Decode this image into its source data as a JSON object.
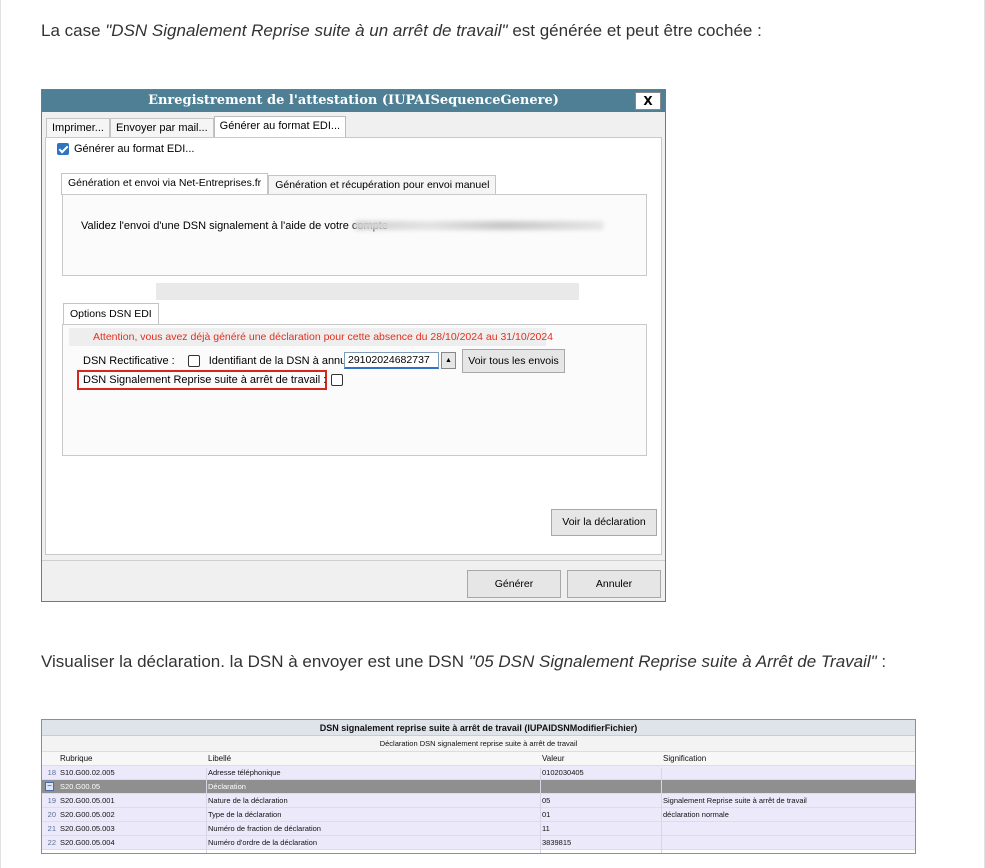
{
  "para1": {
    "before": "La case ",
    "em": "\"DSN Signalement Reprise suite à un arrêt de travail\"",
    "after": " est générée et peut être cochée :"
  },
  "dialog": {
    "title": "Enregistrement de l'attestation (IUPAISequenceGenere)",
    "close": "X",
    "tabs": [
      "Imprimer...",
      "Envoyer par mail...",
      "Générer au format EDI..."
    ],
    "edi_checkbox_label": "Générer au format EDI...",
    "subtabs": [
      "Génération et envoi via Net-Entreprises.fr",
      "Génération et récupération pour envoi manuel"
    ],
    "validate_text": "Validez l'envoi d'une DSN signalement à l'aide de votre compte",
    "options_tab": "Options DSN EDI",
    "warning": "Attention, vous avez déjà généré une déclaration pour cette absence du 28/10/2024 au 31/10/2024",
    "rectificative_label": "DSN Rectificative :",
    "identifiant_label": "Identifiant de la DSN à annuler",
    "identifiant_value": "29102024682737",
    "voir_envois": "Voir tous les envois",
    "reprise_label": "DSN Signalement Reprise suite à arrêt de travail :",
    "voir_declaration": "Voir la déclaration",
    "generer": "Générer",
    "annuler": "Annuler"
  },
  "para2": {
    "before": "Visualiser la déclaration. la DSN à envoyer est une DSN ",
    "em": "\"05 DSN Signalement Reprise suite à Arrêt de Travail\"",
    "after": " :"
  },
  "grid": {
    "title": "DSN signalement reprise suite à arrêt de travail (IUPAIDSNModifierFichier)",
    "subtitle": "Déclaration DSN signalement reprise suite à arrêt de travail",
    "headers": {
      "rubrique": "Rubrique",
      "libelle": "Libellé",
      "valeur": "Valeur",
      "signification": "Signification"
    },
    "rows": [
      {
        "num": "18",
        "rubrique": "S10.G00.02.005",
        "libelle": "Adresse téléphonique",
        "valeur": "0102030405",
        "signification": ""
      },
      {
        "num": "",
        "rubrique": "S20.G00.05",
        "libelle": "Déclaration",
        "valeur": "",
        "signification": ""
      },
      {
        "num": "19",
        "rubrique": "S20.G00.05.001",
        "libelle": "Nature de la déclaration",
        "valeur": "05",
        "signification": "Signalement Reprise suite à arrêt de travail"
      },
      {
        "num": "20",
        "rubrique": "S20.G00.05.002",
        "libelle": "Type de la déclaration",
        "valeur": "01",
        "signification": "déclaration normale"
      },
      {
        "num": "21",
        "rubrique": "S20.G00.05.003",
        "libelle": "Numéro de fraction de déclaration",
        "valeur": "11",
        "signification": ""
      },
      {
        "num": "22",
        "rubrique": "S20.G00.05.004",
        "libelle": "Numéro d'ordre de la déclaration",
        "valeur": "3839815",
        "signification": ""
      }
    ]
  }
}
